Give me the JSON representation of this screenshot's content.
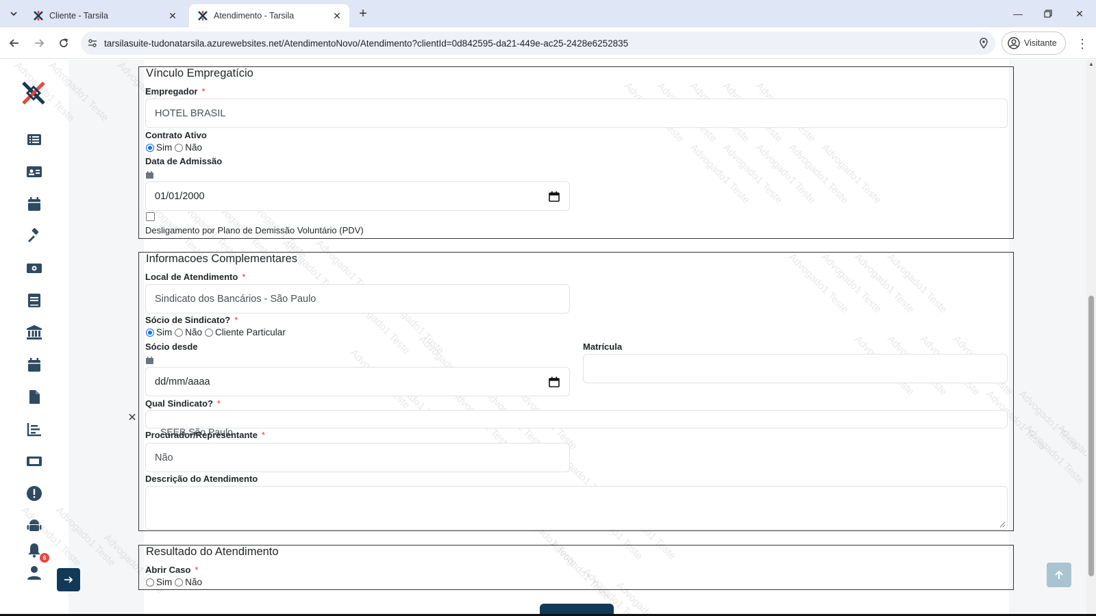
{
  "browser": {
    "tabs": [
      {
        "title": "Cliente - Tarsila",
        "active": false
      },
      {
        "title": "Atendimento - Tarsila",
        "active": true
      }
    ],
    "url": "tarsilasuite-tudonatarsila.azurewebsites.net/AtendimentoNovo/Atendimento?clientId=0d842595-da21-449e-ac25-2428e6252835",
    "profile_label": "Visitante"
  },
  "sidebar": {
    "icons": [
      "list-icon",
      "id-card-icon",
      "calendar-icon",
      "gavel-icon",
      "money-icon",
      "book-icon",
      "bank-icon",
      "calendar-alt-icon",
      "file-icon",
      "chart-icon",
      "ticket-icon",
      "alert-icon",
      "android-icon",
      "bell-icon",
      "user-icon"
    ],
    "notification_count": "6"
  },
  "watermark_text": "Advogado1 Teste",
  "vinculo": {
    "title": "Vínculo Empregatício",
    "empregador_label": "Empregador",
    "empregador_value": "HOTEL BRASIL",
    "contrato_label": "Contrato Ativo",
    "sim": "Sim",
    "nao": "Não",
    "admissao_label": "Data de Admissão",
    "admissao_value": "01/01/2000",
    "pdv_label": "Desligamento por Plano de Demissão Voluntário (PDV)"
  },
  "complementares": {
    "title": "Informacoes Complementares",
    "local_label": "Local de Atendimento",
    "local_value": "Sindicato dos Bancários - São Paulo",
    "socio_label": "Sócio de Sindicato?",
    "sim": "Sim",
    "nao": "Não",
    "particular": "Cliente Particular",
    "socio_desde_label": "Sócio desde",
    "socio_desde_value": "dd/mm/aaaa",
    "matricula_label": "Matrícula",
    "matricula_value": "",
    "qual_label": "Qual Sindicato?",
    "qual_value": "SEEB São Paulo",
    "procurador_label": "Procurador/Representante",
    "procurador_value": "Não",
    "descricao_label": "Descrição do Atendimento",
    "descricao_value": ""
  },
  "resultado": {
    "title": "Resultado do Atendimento",
    "abrir_label": "Abrir Caso",
    "sim": "Sim",
    "nao": "Não"
  },
  "required_mark": "*",
  "colors": {
    "brand_dark": "#103a57",
    "brand_red": "#e8453c",
    "radio_blue": "#0d6efd"
  }
}
